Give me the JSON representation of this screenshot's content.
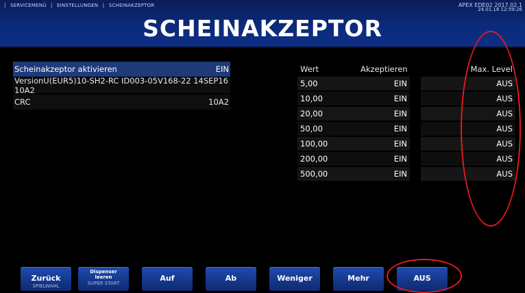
{
  "header": {
    "breadcrumb": [
      "|",
      "SERVICEMENÜ",
      "|",
      "EINSTELLUNGEN",
      "|",
      "SCHEINAKZEPTOR"
    ],
    "title": "SCHEINAKZEPTOR",
    "device_id": "APEX EDE02 2017.02.1",
    "datetime": "24.01.18 12:59:26"
  },
  "left_list": [
    {
      "label": "Scheinakzeptor aktivieren",
      "value": "EIN"
    },
    {
      "label": "VersionU(EUR5)10-SH2-RC ID003-05V168-22 14SEP16 10A2",
      "value": ""
    },
    {
      "label": "CRC",
      "value": "10A2"
    }
  ],
  "table": {
    "headers": {
      "wert": "Wert",
      "akzeptieren": "Akzeptieren",
      "max_level": "Max. Level"
    },
    "rows": [
      {
        "wert": "5,00",
        "akzeptieren": "EIN",
        "max_level": "AUS"
      },
      {
        "wert": "10,00",
        "akzeptieren": "EIN",
        "max_level": "AUS"
      },
      {
        "wert": "20,00",
        "akzeptieren": "EIN",
        "max_level": "AUS"
      },
      {
        "wert": "50,00",
        "akzeptieren": "EIN",
        "max_level": "AUS"
      },
      {
        "wert": "100,00",
        "akzeptieren": "EIN",
        "max_level": "AUS"
      },
      {
        "wert": "200,00",
        "akzeptieren": "EIN",
        "max_level": "AUS"
      },
      {
        "wert": "500,00",
        "akzeptieren": "EIN",
        "max_level": "AUS"
      }
    ]
  },
  "buttons": [
    {
      "label": "Zurück",
      "sub": "SPIELWAHL"
    },
    {
      "label": "Dispenser leeren",
      "sub": "SUPER START"
    },
    {
      "label": "Auf",
      "sub": ""
    },
    {
      "label": "Ab",
      "sub": ""
    },
    {
      "label": "Weniger",
      "sub": ""
    },
    {
      "label": "Mehr",
      "sub": ""
    },
    {
      "label": "AUS",
      "sub": ""
    }
  ],
  "colors": {
    "header_blue": "#0b2a7a",
    "button_blue": "#163a8f",
    "annotation_red": "#e21b1b",
    "selected_row": "#1f3a7a"
  }
}
